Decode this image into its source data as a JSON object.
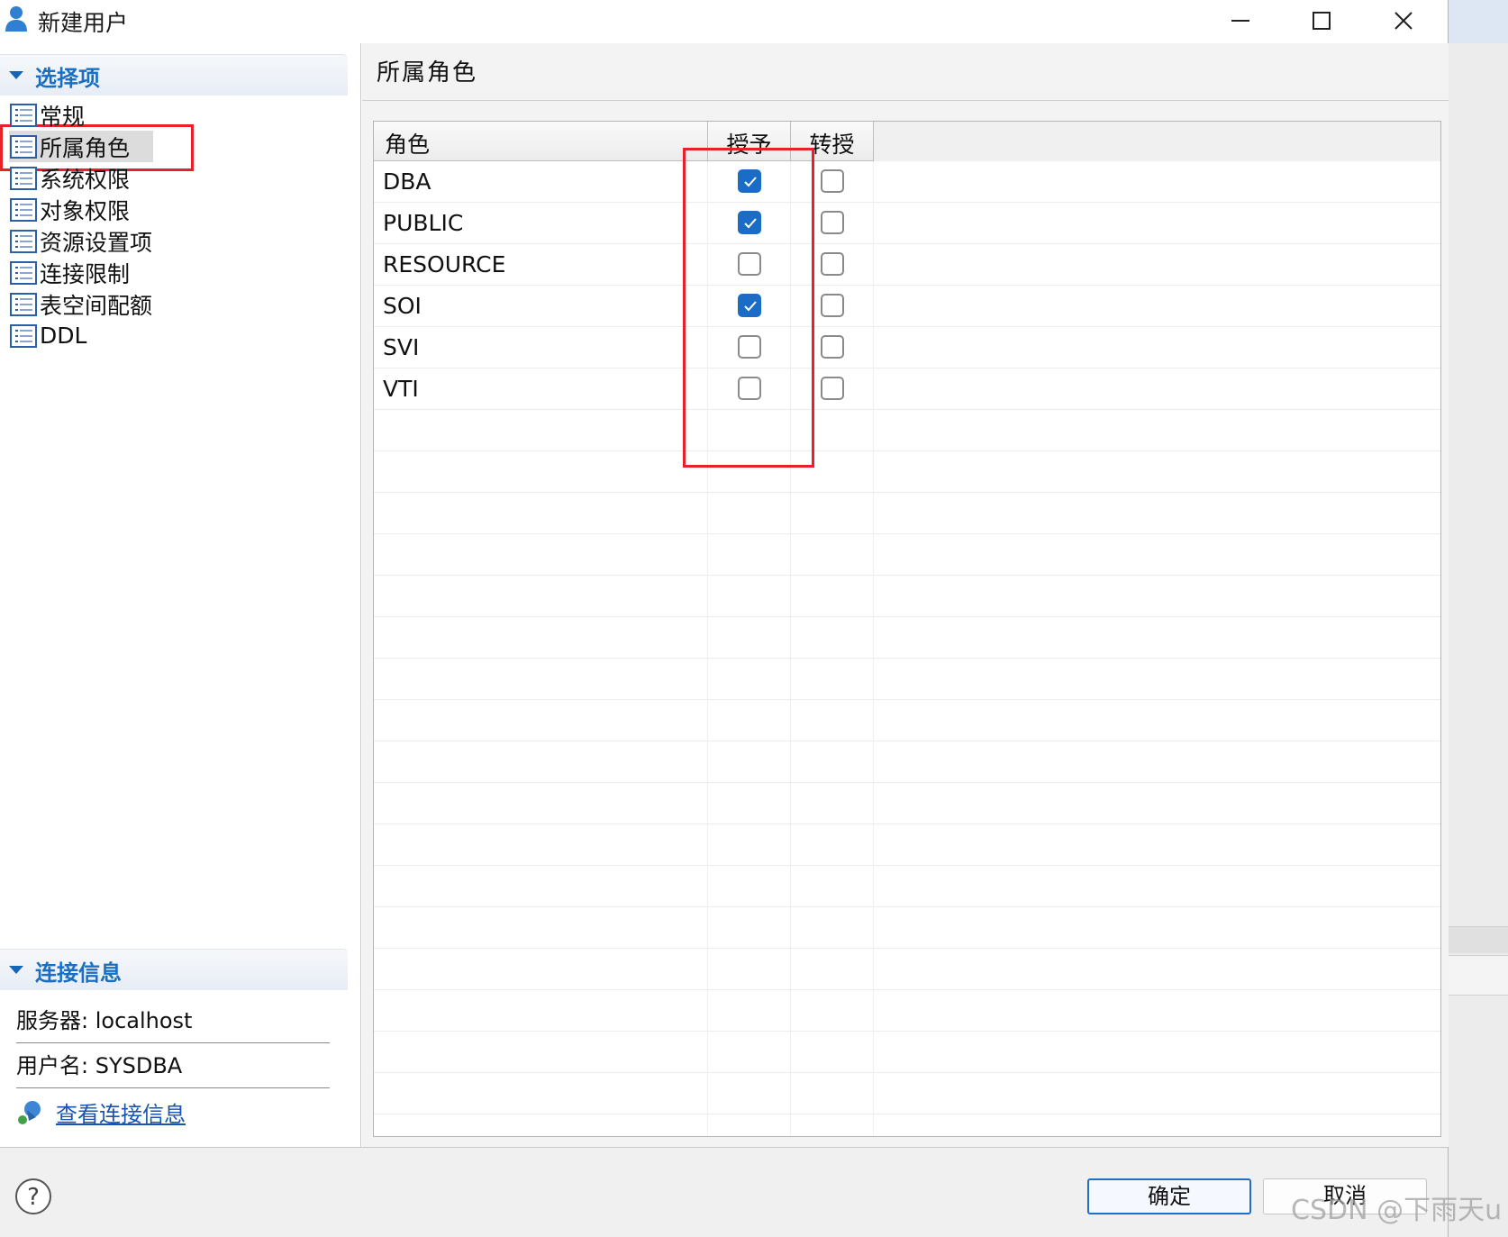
{
  "window": {
    "title": "新建用户"
  },
  "left": {
    "options_header": "选择项",
    "nav_items": [
      {
        "label": "常规"
      },
      {
        "label": "所属角色"
      },
      {
        "label": "系统权限"
      },
      {
        "label": "对象权限"
      },
      {
        "label": "资源设置项"
      },
      {
        "label": "连接限制"
      },
      {
        "label": "表空间配额"
      },
      {
        "label": "DDL"
      }
    ],
    "selected_index": 1,
    "connection_header": "连接信息",
    "server_line": "服务器: localhost",
    "user_line": "用户名: SYSDBA",
    "view_link": "查看连接信息"
  },
  "main": {
    "page_title": "所属角色",
    "columns": {
      "role": "角色",
      "grant": "授予",
      "transfer": "转授"
    },
    "rows": [
      {
        "role": "DBA",
        "grant": true,
        "transfer": false
      },
      {
        "role": "PUBLIC",
        "grant": true,
        "transfer": false
      },
      {
        "role": "RESOURCE",
        "grant": false,
        "transfer": false
      },
      {
        "role": "SOI",
        "grant": true,
        "transfer": false
      },
      {
        "role": "SVI",
        "grant": false,
        "transfer": false
      },
      {
        "role": "VTI",
        "grant": false,
        "transfer": false
      }
    ]
  },
  "buttons": {
    "ok": "确定",
    "cancel": "取消"
  },
  "watermark": "CSDN @下雨天u",
  "colors": {
    "accent": "#1a6cc7",
    "highlight": "#e8202a",
    "link": "#1a53b6"
  }
}
